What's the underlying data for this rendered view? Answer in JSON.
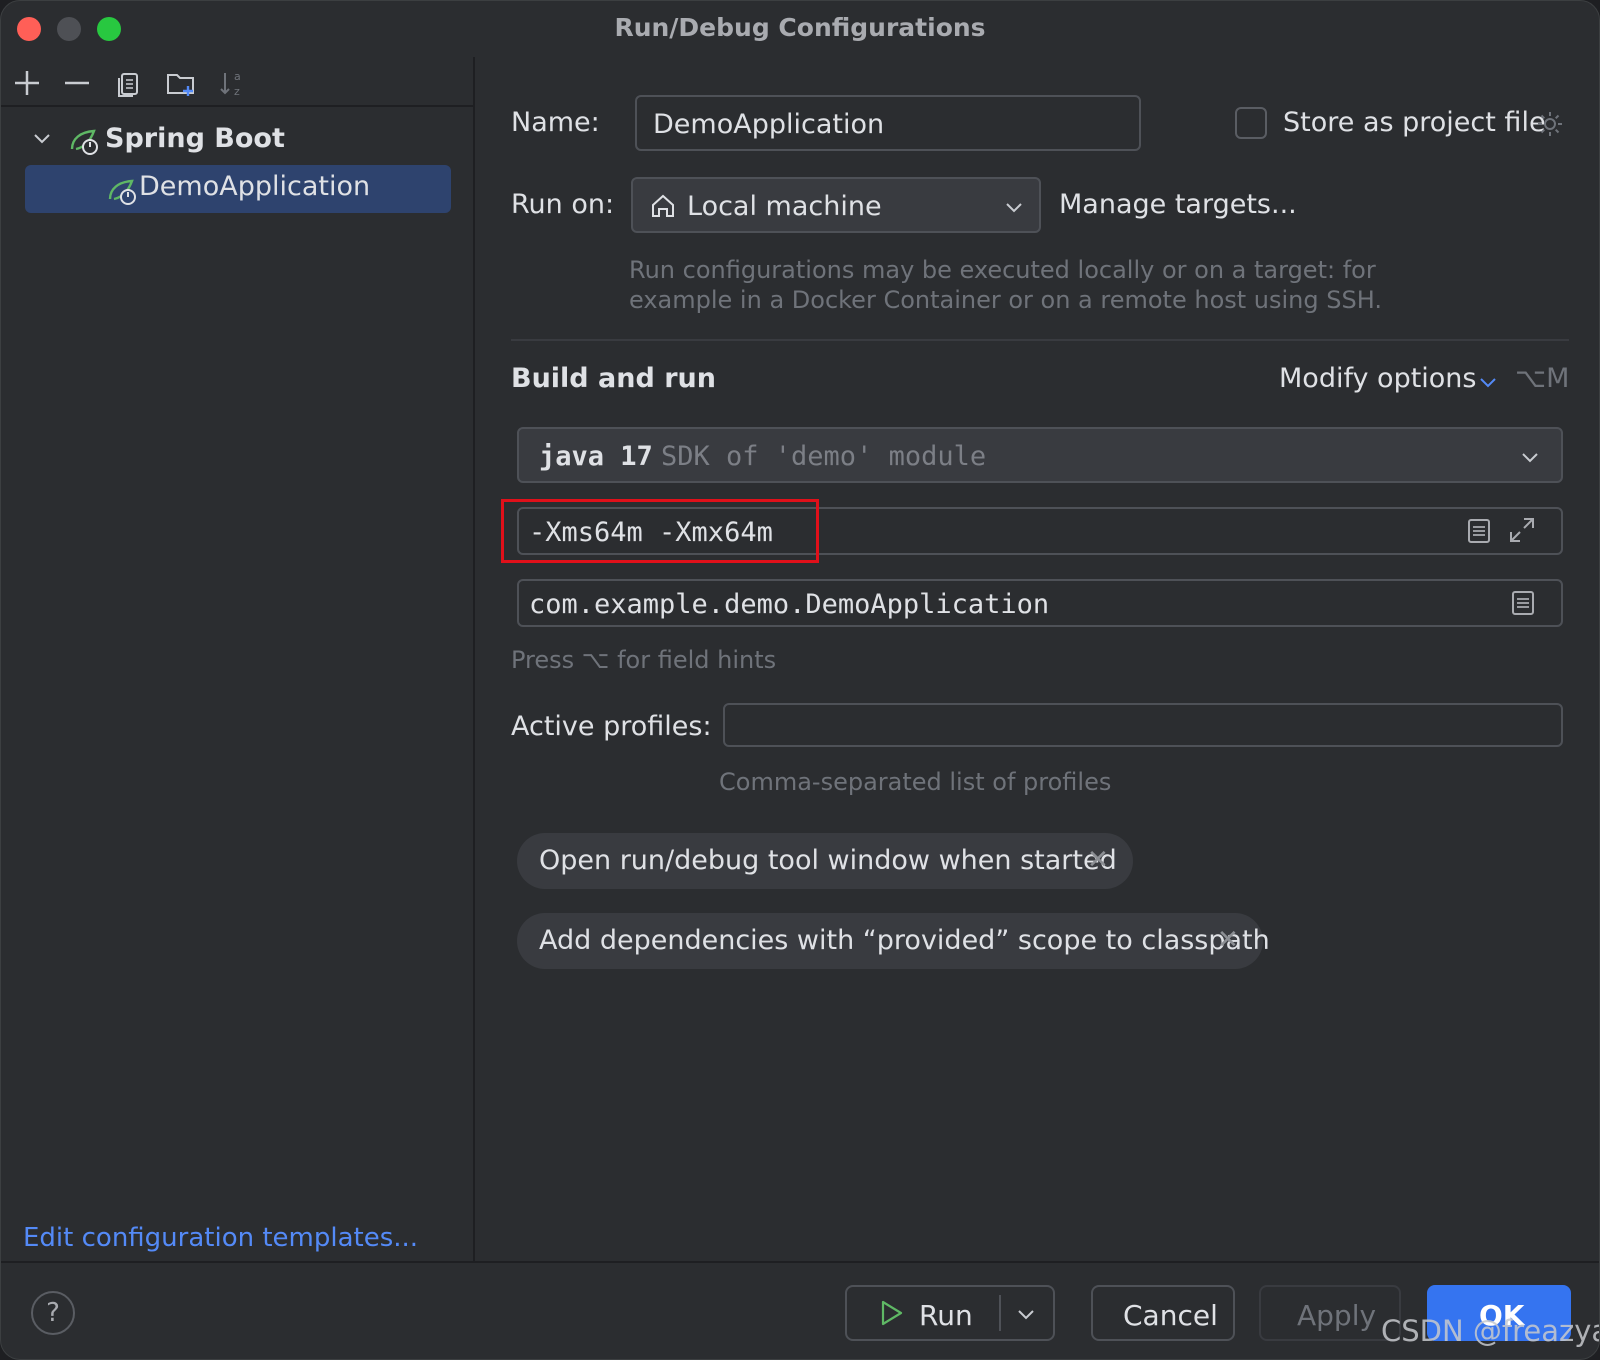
{
  "window": {
    "title": "Run/Debug Configurations"
  },
  "toolbar": {
    "icons": [
      "add-icon",
      "remove-icon",
      "copy-icon",
      "new-folder-icon",
      "sort-icon"
    ]
  },
  "tree": {
    "group": {
      "label": "Spring Boot",
      "icon": "spring-boot-icon",
      "expanded": true
    },
    "items": [
      {
        "label": "DemoApplication",
        "selected": true,
        "icon": "spring-boot-icon"
      }
    ]
  },
  "left_footer": {
    "edit_templates": "Edit configuration templates..."
  },
  "form": {
    "name_label": "Name:",
    "name_value": "DemoApplication",
    "store_label": "Store as project file",
    "store_checked": false,
    "run_on_label": "Run on:",
    "run_on_value": "Local machine",
    "manage_targets": "Manage targets...",
    "run_on_hint_line1": "Run configurations may be executed locally or on a target: for",
    "run_on_hint_line2": "example in a Docker Container or on a remote host using SSH.",
    "section_title": "Build and run",
    "modify_options": "Modify options",
    "modify_shortcut": "⌥M",
    "sdk_name": "java 17",
    "sdk_hint": "SDK of 'demo' module",
    "vm_options": "-Xms64m -Xmx64m",
    "main_class": "com.example.demo.DemoApplication",
    "field_hints": "Press ⌥ for field hints",
    "profiles_label": "Active profiles:",
    "profiles_value": "",
    "profiles_hint": "Comma-separated list of profiles",
    "chips": [
      "Open run/debug tool window when started",
      "Add dependencies with “provided” scope to classpath"
    ]
  },
  "buttons": {
    "help": "?",
    "run": "Run",
    "cancel": "Cancel",
    "apply": "Apply",
    "ok": "OK"
  },
  "watermark": "CSDN @freazya",
  "colors": {
    "accent": "#548af7",
    "selection": "#2e436e",
    "ok_button": "#3574f0",
    "highlight_box": "#e0101a",
    "run_icon": "#5fb865"
  }
}
